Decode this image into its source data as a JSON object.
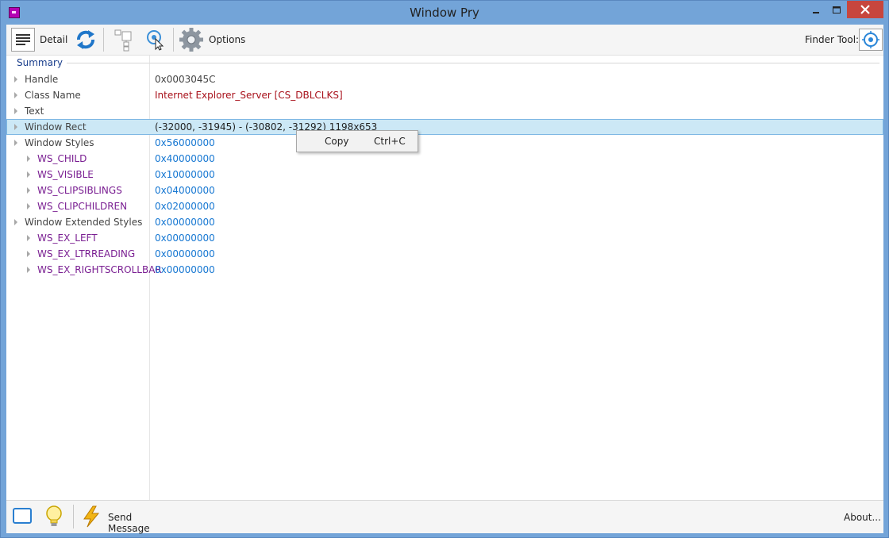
{
  "window": {
    "title": "Window Pry"
  },
  "toolbar": {
    "detail_label": "Detail",
    "options_label": "Options",
    "finder_label": "Finder Tool:"
  },
  "tree": {
    "section": "Summary",
    "rows": [
      {
        "name": "Handle",
        "value": "0x0003045C"
      },
      {
        "name": "Class Name",
        "value": "Internet Explorer_Server [CS_DBLCLKS]"
      },
      {
        "name": "Text",
        "value": ""
      },
      {
        "name": "Window Rect",
        "value": "(-32000, -31945) - (-30802, -31292) 1198x653"
      },
      {
        "name": "Window Styles",
        "value": "0x56000000"
      },
      {
        "name": "WS_CHILD",
        "value": "0x40000000"
      },
      {
        "name": "WS_VISIBLE",
        "value": "0x10000000"
      },
      {
        "name": "WS_CLIPSIBLINGS",
        "value": "0x04000000"
      },
      {
        "name": "WS_CLIPCHILDREN",
        "value": "0x02000000"
      },
      {
        "name": "Window Extended Styles",
        "value": "0x00000000"
      },
      {
        "name": "WS_EX_LEFT",
        "value": "0x00000000"
      },
      {
        "name": "WS_EX_LTRREADING",
        "value": "0x00000000"
      },
      {
        "name": "WS_EX_RIGHTSCROLLBAR",
        "value": "0x00000000"
      }
    ]
  },
  "context_menu": {
    "label": "Copy",
    "shortcut": "Ctrl+C"
  },
  "statusbar": {
    "send_label": "Send Message",
    "about_label": "About..."
  },
  "colors": {
    "selection": "#cce8f6",
    "style_name": "#7a1f92",
    "style_value": "#1677d2",
    "class_value": "#a8101a"
  }
}
